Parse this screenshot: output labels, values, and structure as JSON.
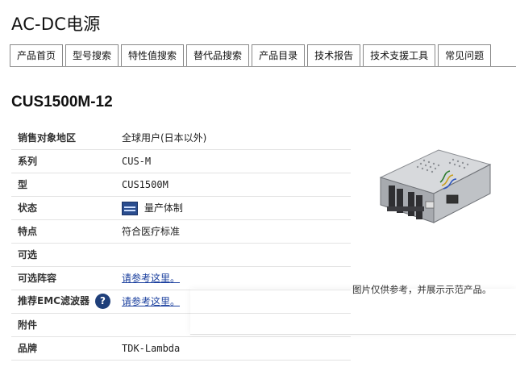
{
  "page_title": "AC-DC电源",
  "tabs": [
    {
      "label": "产品首页"
    },
    {
      "label": "型号搜索"
    },
    {
      "label": "特性值搜索"
    },
    {
      "label": "替代品搜索"
    },
    {
      "label": "产品目录"
    },
    {
      "label": "技术报告"
    },
    {
      "label": "技术支援工具"
    },
    {
      "label": "常见问题"
    }
  ],
  "product": {
    "title": "CUS1500M-12",
    "specs": [
      {
        "label": "销售对象地区",
        "value": "全球用户(日本以外)"
      },
      {
        "label": "系列",
        "value": "CUS-M"
      },
      {
        "label": "型",
        "value": "CUS1500M"
      },
      {
        "label": "状态",
        "value": "量产体制",
        "icon": "production-status-icon"
      },
      {
        "label": "特点",
        "value": "符合医疗标准"
      },
      {
        "label": "可选",
        "value": ""
      },
      {
        "label": "可选阵容",
        "value": "请参考这里。",
        "link": true
      },
      {
        "label": "推荐EMC滤波器",
        "value": "请参考这里。",
        "link": true,
        "help_icon": "?"
      },
      {
        "label": "附件",
        "value": ""
      },
      {
        "label": "品牌",
        "value": "TDK-Lambda"
      }
    ]
  },
  "image": {
    "icon": "power-supply-product-image",
    "caption": "图片仅供参考，并展示示范产品。"
  }
}
